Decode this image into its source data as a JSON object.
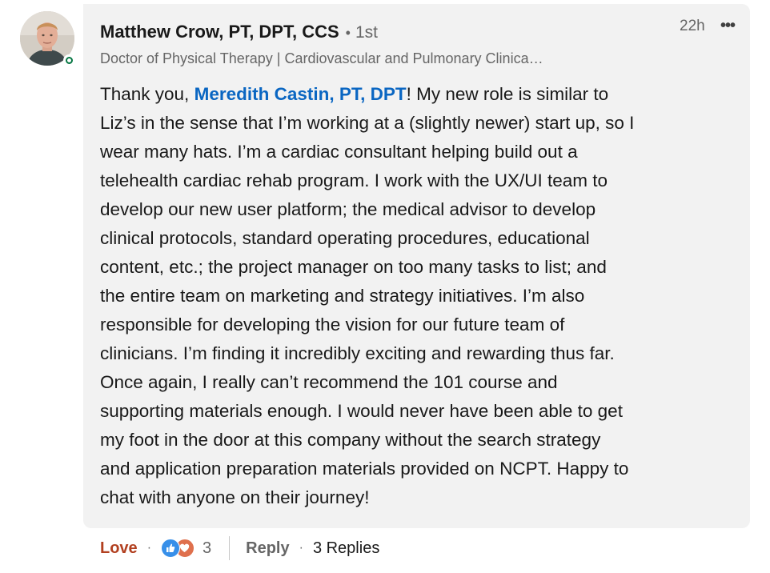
{
  "comment": {
    "author_name": "Matthew Crow, PT, DPT, CCS",
    "separator": "•",
    "connection_degree": "1st",
    "headline": "Doctor of Physical Therapy | Cardiovascular and Pulmonary Clinica…",
    "time_ago": "22h",
    "more_label": "•••",
    "body": {
      "line1_prefix": "Thank you, ",
      "mention": "Meredith Castin, PT, DPT",
      "line1_suffix": "! My new role is similar to",
      "lines": [
        "Liz’s in the sense that I’m working at a (slightly newer) start up, so I",
        "wear many hats. I’m a cardiac consultant helping build out a",
        "telehealth cardiac rehab program. I work with the UX/UI team to",
        "develop our new user platform; the medical advisor to develop",
        "clinical protocols, standard operating procedures, educational",
        "content, etc.; the project manager on too many tasks to list; and",
        "the entire team on marketing and strategy initiatives. I’m also",
        "responsible for developing the vision for our future team of",
        "clinicians. I’m finding it incredibly exciting and rewarding thus far.",
        "Once again, I really can’t recommend the 101 course and",
        "supporting materials enough. I would never have been able to get",
        "my foot in the door at this company without the search strategy",
        "and application preparation materials provided on NCPT. Happy to",
        "chat with anyone on their journey!"
      ]
    },
    "actions": {
      "reaction_label": "Love",
      "dot": "·",
      "reaction_icons": [
        "like-icon",
        "love-icon"
      ],
      "reaction_count": "3",
      "reply_label": "Reply",
      "replies_label": "3 Replies"
    },
    "colors": {
      "mention": "#0a66c2",
      "love": "#b24020",
      "bubble_bg": "#f2f2f2",
      "presence": "#057642"
    }
  }
}
